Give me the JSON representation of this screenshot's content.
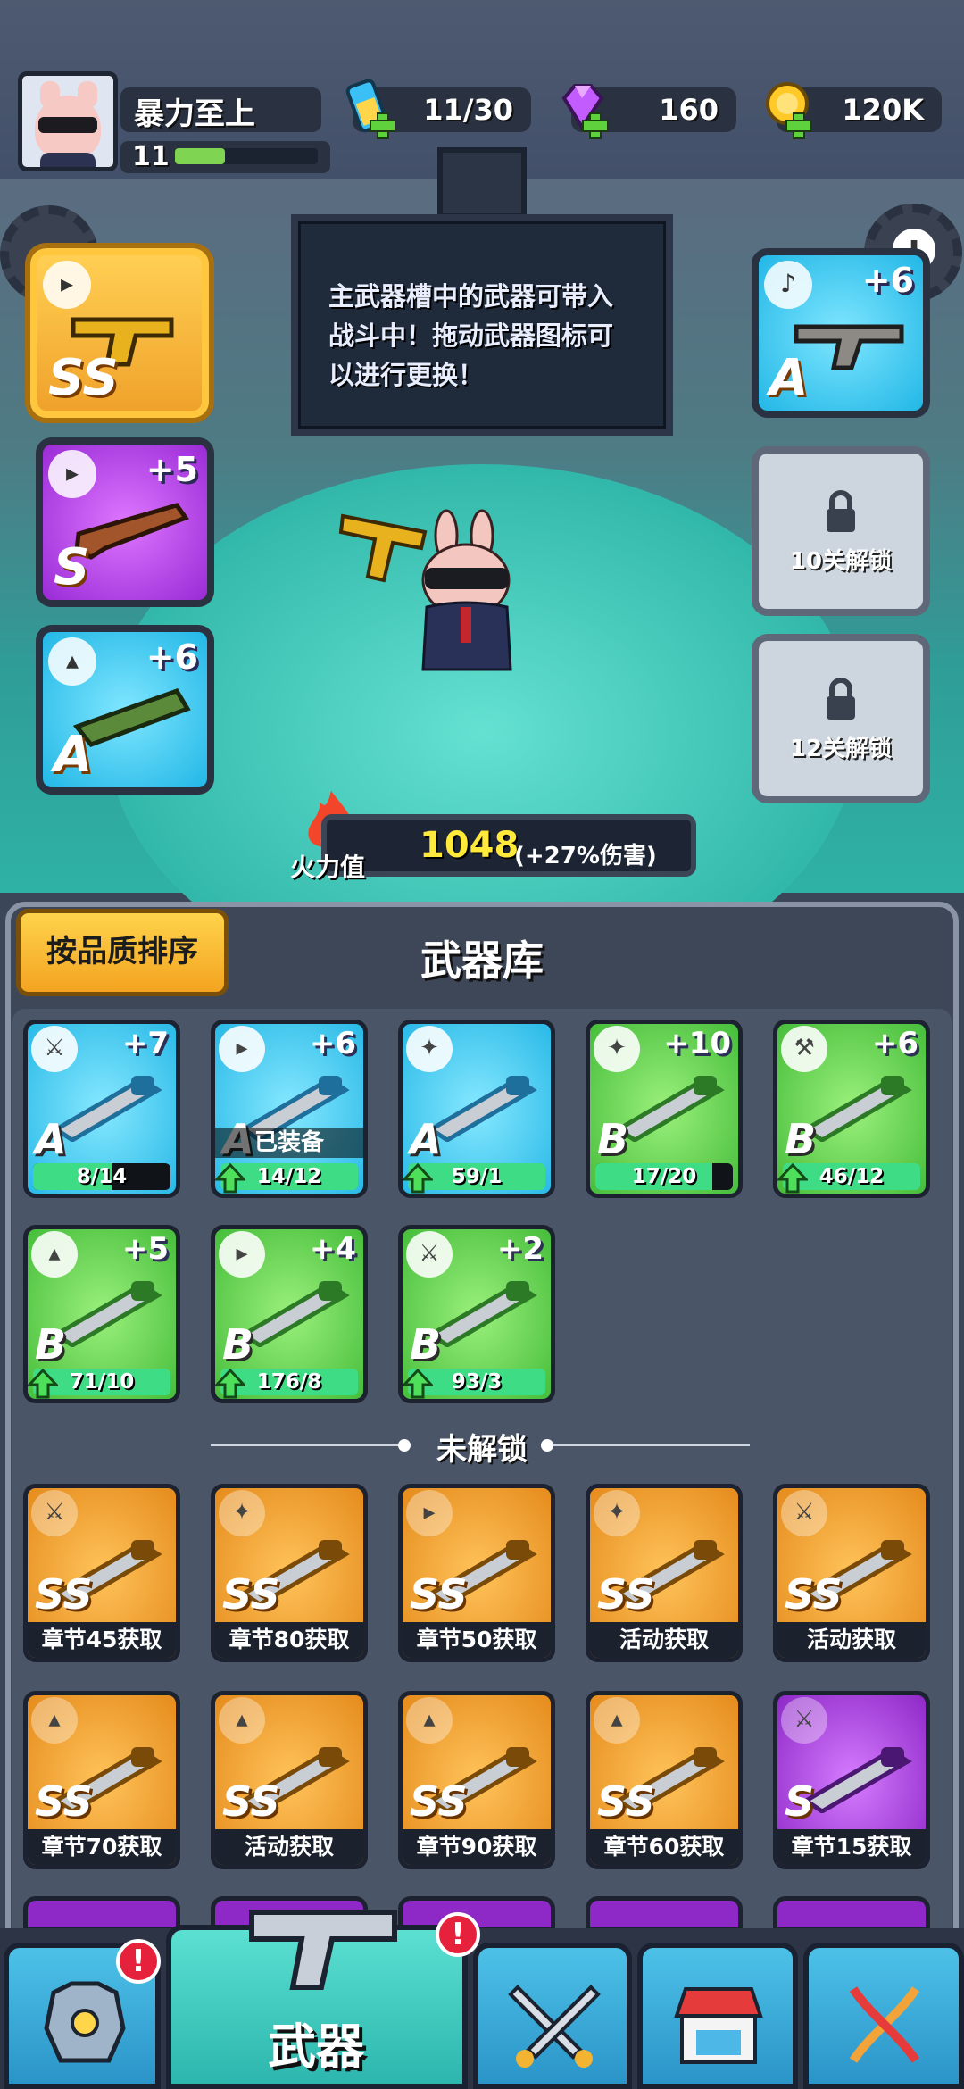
{
  "player": {
    "name": "暴力至上",
    "level": "11",
    "xp_fraction": 0.35
  },
  "resources": {
    "energy": "11/30",
    "gems": "160",
    "coins": "120K"
  },
  "tip": "主武器槽中的武器可带入战斗中！拖动武器图标可以进行更换！",
  "left_slots": [
    {
      "type": "pistol-icon",
      "grade": "SS",
      "plus": "",
      "color": "#f2a62c"
    },
    {
      "type": "pistol-icon",
      "grade": "S",
      "plus": "+5",
      "color": "#a634dd"
    },
    {
      "type": "rocket-icon",
      "grade": "A",
      "plus": "+6",
      "color": "#2bb9e6"
    }
  ],
  "right_slots": [
    {
      "type": "music-icon",
      "grade": "A",
      "plus": "+6"
    },
    {
      "locked": true,
      "text": "10关解锁"
    },
    {
      "locked": true,
      "text": "12关解锁"
    }
  ],
  "firepower": {
    "label": "火力值",
    "value": "1048",
    "bonus": "(+27%伤害)"
  },
  "armory": {
    "sort_label": "按品质排序",
    "title": "武器库",
    "owned": [
      {
        "icon": "sword-icon",
        "grade": "A",
        "plus": "+7",
        "progress": "8/14",
        "fill": 0.57,
        "upgradable": false,
        "tier": "cyan"
      },
      {
        "icon": "pistol-icon",
        "grade": "A",
        "plus": "+6",
        "progress": "14/12",
        "fill": 1,
        "upgradable": true,
        "equipped": "已装备",
        "tier": "cyan"
      },
      {
        "icon": "staff-icon",
        "grade": "A",
        "plus": "",
        "progress": "59/1",
        "fill": 1,
        "upgradable": true,
        "tier": "cyan"
      },
      {
        "icon": "staff-icon",
        "grade": "B",
        "plus": "+10",
        "progress": "17/20",
        "fill": 0.85,
        "upgradable": false,
        "tier": "green"
      },
      {
        "icon": "hammer-icon",
        "grade": "B",
        "plus": "+6",
        "progress": "46/12",
        "fill": 1,
        "upgradable": true,
        "tier": "green"
      },
      {
        "icon": "rocket-icon",
        "grade": "B",
        "plus": "+5",
        "progress": "71/10",
        "fill": 1,
        "upgradable": true,
        "tier": "green"
      },
      {
        "icon": "pistol-icon",
        "grade": "B",
        "plus": "+4",
        "progress": "176/8",
        "fill": 1,
        "upgradable": true,
        "tier": "green"
      },
      {
        "icon": "sword-icon",
        "grade": "B",
        "plus": "+2",
        "progress": "93/3",
        "fill": 1,
        "upgradable": true,
        "tier": "green"
      }
    ],
    "locked_title": "未解锁",
    "locked": [
      {
        "icon": "sword-icon",
        "grade": "SS",
        "source": "章节45获取",
        "tier": "gold"
      },
      {
        "icon": "staff-icon",
        "grade": "SS",
        "source": "章节80获取",
        "tier": "gold"
      },
      {
        "icon": "pistol-icon",
        "grade": "SS",
        "source": "章节50获取",
        "tier": "gold"
      },
      {
        "icon": "staff-icon",
        "grade": "SS",
        "source": "活动获取",
        "tier": "gold"
      },
      {
        "icon": "sword-icon",
        "grade": "SS",
        "source": "活动获取",
        "tier": "gold"
      },
      {
        "icon": "rocket-icon",
        "grade": "SS",
        "source": "章节70获取",
        "tier": "gold"
      },
      {
        "icon": "rocket-icon",
        "grade": "SS",
        "source": "活动获取",
        "tier": "gold"
      },
      {
        "icon": "rocket-icon",
        "grade": "SS",
        "source": "章节90获取",
        "tier": "gold"
      },
      {
        "icon": "rocket-icon",
        "grade": "SS",
        "source": "章节60获取",
        "tier": "gold"
      },
      {
        "icon": "sword-icon",
        "grade": "S",
        "source": "章节15获取",
        "tier": "purple"
      }
    ]
  },
  "nav": {
    "weapons_label": "武器",
    "alert": "!"
  }
}
